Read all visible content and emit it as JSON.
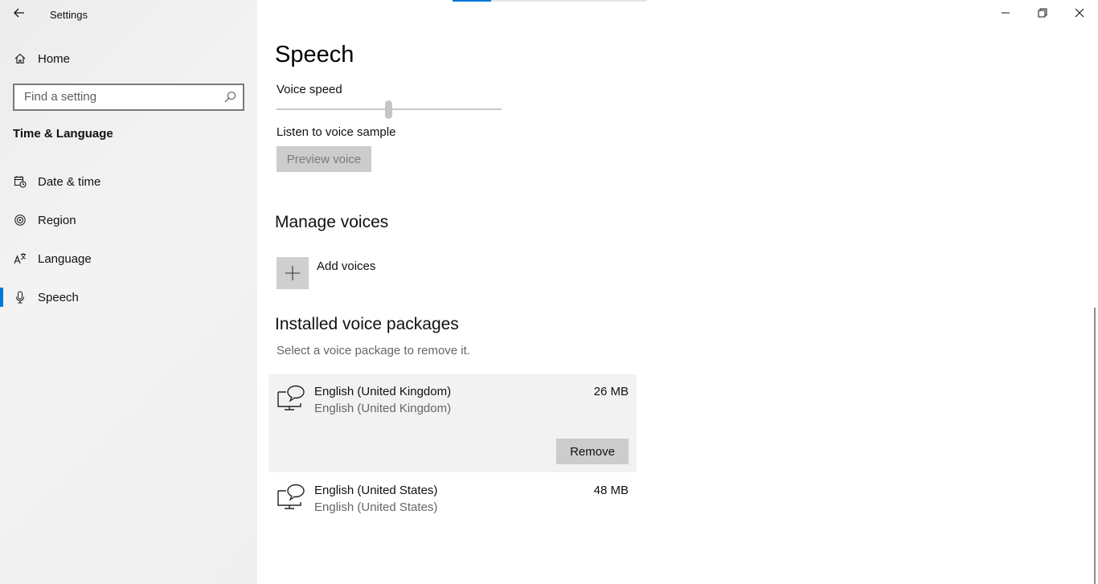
{
  "app": {
    "title": "Settings"
  },
  "window_controls": {
    "icons": [
      "minimize-icon",
      "restore-icon",
      "close-icon"
    ]
  },
  "sidebar": {
    "home_label": "Home",
    "search_placeholder": "Find a setting",
    "section_title": "Time & Language",
    "items": [
      {
        "label": "Date & time",
        "icon": "calendar-clock-icon"
      },
      {
        "label": "Region",
        "icon": "globe-icon"
      },
      {
        "label": "Language",
        "icon": "language-icon"
      },
      {
        "label": "Speech",
        "icon": "microphone-icon",
        "selected": true
      }
    ]
  },
  "colors": {
    "accent": "#0078d7",
    "selected_row": "#f2f2f2",
    "button": "#cccccc"
  },
  "main": {
    "title": "Speech",
    "voice_speed_label": "Voice speed",
    "voice_speed_level": 0.5,
    "listen_label": "Listen to voice sample",
    "preview_button": "Preview voice",
    "manage_voices_heading": "Manage voices",
    "add_voices_label": "Add voices",
    "installed_heading": "Installed voice packages",
    "installed_hint": "Select a voice package to remove it.",
    "packages": [
      {
        "name": "English (United Kingdom)",
        "sub": "English (United Kingdom)",
        "size": "26 MB",
        "selected": true,
        "remove_label": "Remove"
      },
      {
        "name": "English (United States)",
        "sub": "English (United States)",
        "size": "48 MB",
        "selected": false
      }
    ]
  }
}
